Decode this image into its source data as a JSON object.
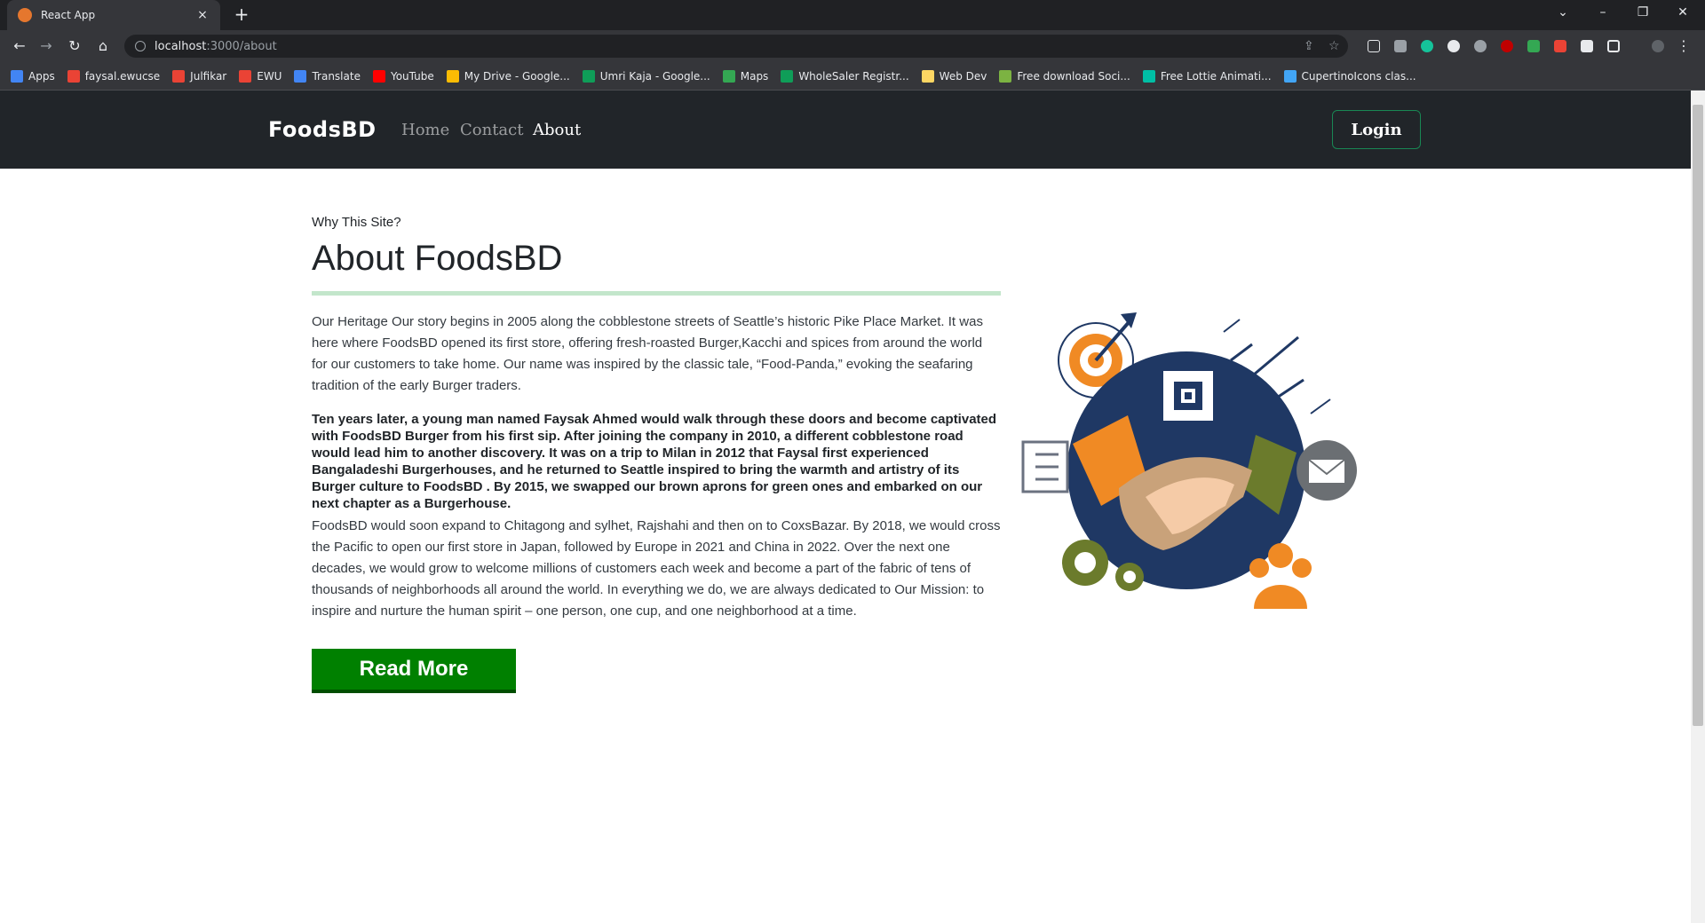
{
  "browser": {
    "tab_title": "React App",
    "url_host": "localhost",
    "url_path": ":3000/about",
    "bookmarks": [
      {
        "label": "Apps",
        "color": "#4285f4"
      },
      {
        "label": "faysal.ewucse",
        "color": "#ea4335"
      },
      {
        "label": "Julfikar",
        "color": "#ea4335"
      },
      {
        "label": "EWU",
        "color": "#ea4335"
      },
      {
        "label": "Translate",
        "color": "#4285f4"
      },
      {
        "label": "YouTube",
        "color": "#ff0000"
      },
      {
        "label": "My Drive - Google...",
        "color": "#fbbc04"
      },
      {
        "label": "Umri Kaja - Google...",
        "color": "#0f9d58"
      },
      {
        "label": "Maps",
        "color": "#34a853"
      },
      {
        "label": "WholeSaler Registr...",
        "color": "#0f9d58"
      },
      {
        "label": "Web Dev",
        "color": "#fdd663"
      },
      {
        "label": "Free download Soci...",
        "color": "#7cb342"
      },
      {
        "label": "Free Lottie Animati...",
        "color": "#00bfa5"
      },
      {
        "label": "CupertinoIcons clas...",
        "color": "#42a5f5"
      }
    ]
  },
  "site": {
    "brand": "FoodsBD",
    "nav": {
      "home": "Home",
      "contact": "Contact",
      "about": "About"
    },
    "login": "Login"
  },
  "about": {
    "eyebrow": "Why This Site?",
    "title": "About FoodsBD",
    "para1": "Our Heritage Our story begins in 2005 along the cobblestone streets of Seattle’s historic Pike Place Market. It was here where FoodsBD opened its first store, offering fresh-roasted Burger,Kacchi and spices from around the world for our customers to take home. Our name was inspired by the classic tale, “Food-Panda,” evoking the seafaring tradition of the early Burger traders.",
    "para2": "Ten years later, a young man named Faysak Ahmed would walk through these doors and become captivated with FoodsBD Burger from his first sip. After joining the company in 2010, a different cobblestone road would lead him to another discovery. It was on a trip to Milan in 2012 that Faysal first experienced Bangaladeshi Burgerhouses, and he returned to Seattle inspired to bring the warmth and artistry of its Burger culture to FoodsBD . By 2015, we swapped our brown aprons for green ones and embarked on our next chapter as a Burgerhouse.",
    "para3": "FoodsBD would soon expand to Chitagong and sylhet, Rajshahi and then on to CoxsBazar. By 2018, we would cross the Pacific to open our first store in Japan, followed by Europe in 2021 and China in 2022. Over the next one decades, we would grow to welcome millions of customers each week and become a part of the fabric of tens of thousands of neighborhoods all around the world. In everything we do, we are always dedicated to Our Mission: to inspire and nurture the human spirit – one person, one cup, and one neighborhood at a time.",
    "read_more": "Read More"
  },
  "colors": {
    "navbar": "#212529",
    "read_more": "#008000",
    "divider": "#c3e6cb",
    "login_border": "#198754"
  }
}
